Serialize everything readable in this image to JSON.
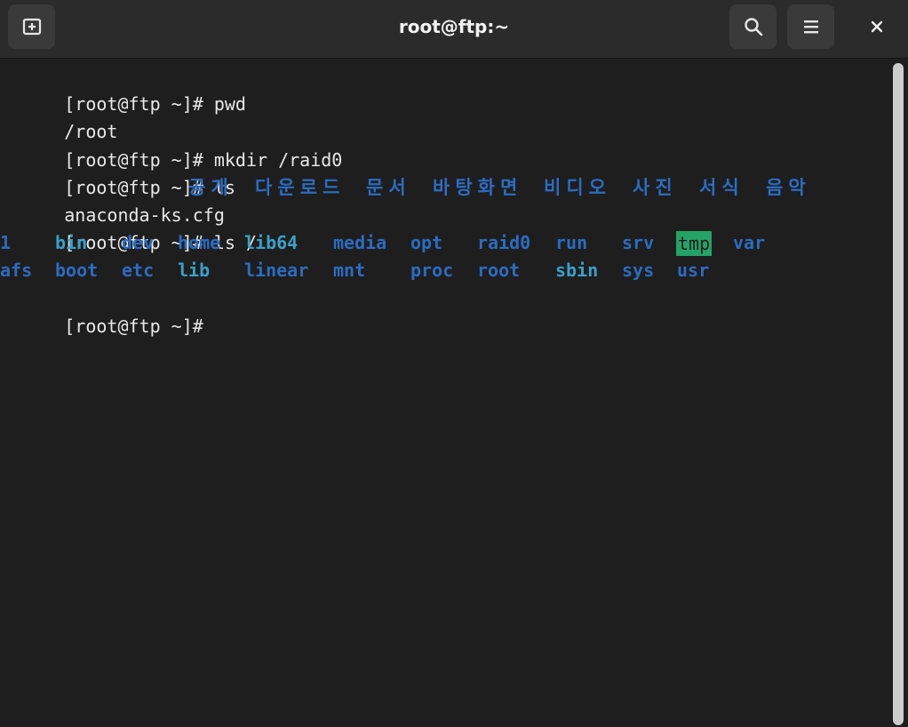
{
  "window": {
    "title": "root@ftp:~"
  },
  "headerbar": {
    "new_tab_icon": "new-tab-icon",
    "search_icon": "search-icon",
    "menu_icon": "hamburger-menu-icon",
    "close_icon": "close-icon"
  },
  "terminal": {
    "lines": [
      "[root@ftp ~]# pwd",
      "/root",
      "[root@ftp ~]# mkdir /raid0",
      "[root@ftp ~]# ls",
      "anaconda-ks.cfg",
      "[root@ftp ~]# ls /",
      "[root@ftp ~]#"
    ],
    "home_dirs": [
      "공개",
      "다운로드",
      "문서",
      "바탕화면",
      "비디오",
      "사진",
      "서식",
      "음악"
    ],
    "root_row1": [
      "1",
      "bin",
      "dev",
      "home",
      "lib64",
      "media",
      "opt",
      "raid0",
      "run",
      "srv",
      "tmp",
      "var"
    ],
    "root_row2": [
      "afs",
      "boot",
      "etc",
      "lib",
      "linear",
      "mnt",
      "proc",
      "root",
      "sbin",
      "sys",
      "usr"
    ]
  },
  "colors": {
    "background": "#1e1e1e",
    "headerbar": "#2b2b2b",
    "directory": "#2b6cc0",
    "symlink": "#3aa0c8",
    "sticky_dir_bg": "#25a265",
    "text": "#e8e8e8"
  }
}
